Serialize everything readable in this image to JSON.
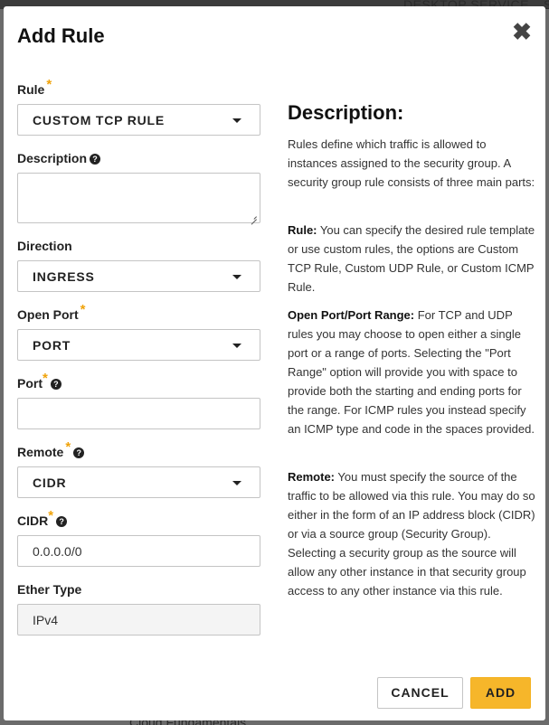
{
  "background": {
    "top_text": "DESKTOP SERVICE",
    "top_right_text": "S",
    "bottom_text": "Cloud Fundamentals"
  },
  "modal": {
    "title": "Add Rule",
    "close_icon": "close-icon"
  },
  "form": {
    "rule": {
      "label": "Rule",
      "required_mark": "*",
      "value": "CUSTOM TCP RULE"
    },
    "description": {
      "label": "Description",
      "value": ""
    },
    "direction": {
      "label": "Direction",
      "value": "INGRESS"
    },
    "open_port": {
      "label": "Open Port",
      "required_mark": "*",
      "value": "PORT"
    },
    "port": {
      "label": "Port",
      "required_mark": "*",
      "value": ""
    },
    "remote": {
      "label": "Remote",
      "required_mark": "*",
      "value": "CIDR"
    },
    "cidr": {
      "label": "CIDR",
      "required_mark": "*",
      "value": "0.0.0.0/0"
    },
    "ether_type": {
      "label": "Ether Type",
      "value": "IPv4"
    },
    "help_icon": "?"
  },
  "help": {
    "title": "Description:",
    "intro": "Rules define which traffic is allowed to instances assigned to the security group. A security group rule consists of three main parts:",
    "rule_term": "Rule:",
    "rule_text": " You can specify the desired rule template or use custom rules, the options are Custom TCP Rule, Custom UDP Rule, or Custom ICMP Rule.",
    "port_term": "Open Port/Port Range:",
    "port_text": " For TCP and UDP rules you may choose to open either a single port or a range of ports. Selecting the \"Port Range\" option will provide you with space to provide both the starting and ending ports for the range. For ICMP rules you instead specify an ICMP type and code in the spaces provided.",
    "remote_term": "Remote:",
    "remote_text": " You must specify the source of the traffic to be allowed via this rule. You may do so either in the form of an IP address block (CIDR) or via a source group (Security Group). Selecting a security group as the source will allow any other instance in that security group access to any other instance via this rule."
  },
  "actions": {
    "cancel_label": "CANCEL",
    "add_label": "ADD"
  },
  "colors": {
    "accent": "#f6b62a",
    "required": "#f0a30a"
  }
}
